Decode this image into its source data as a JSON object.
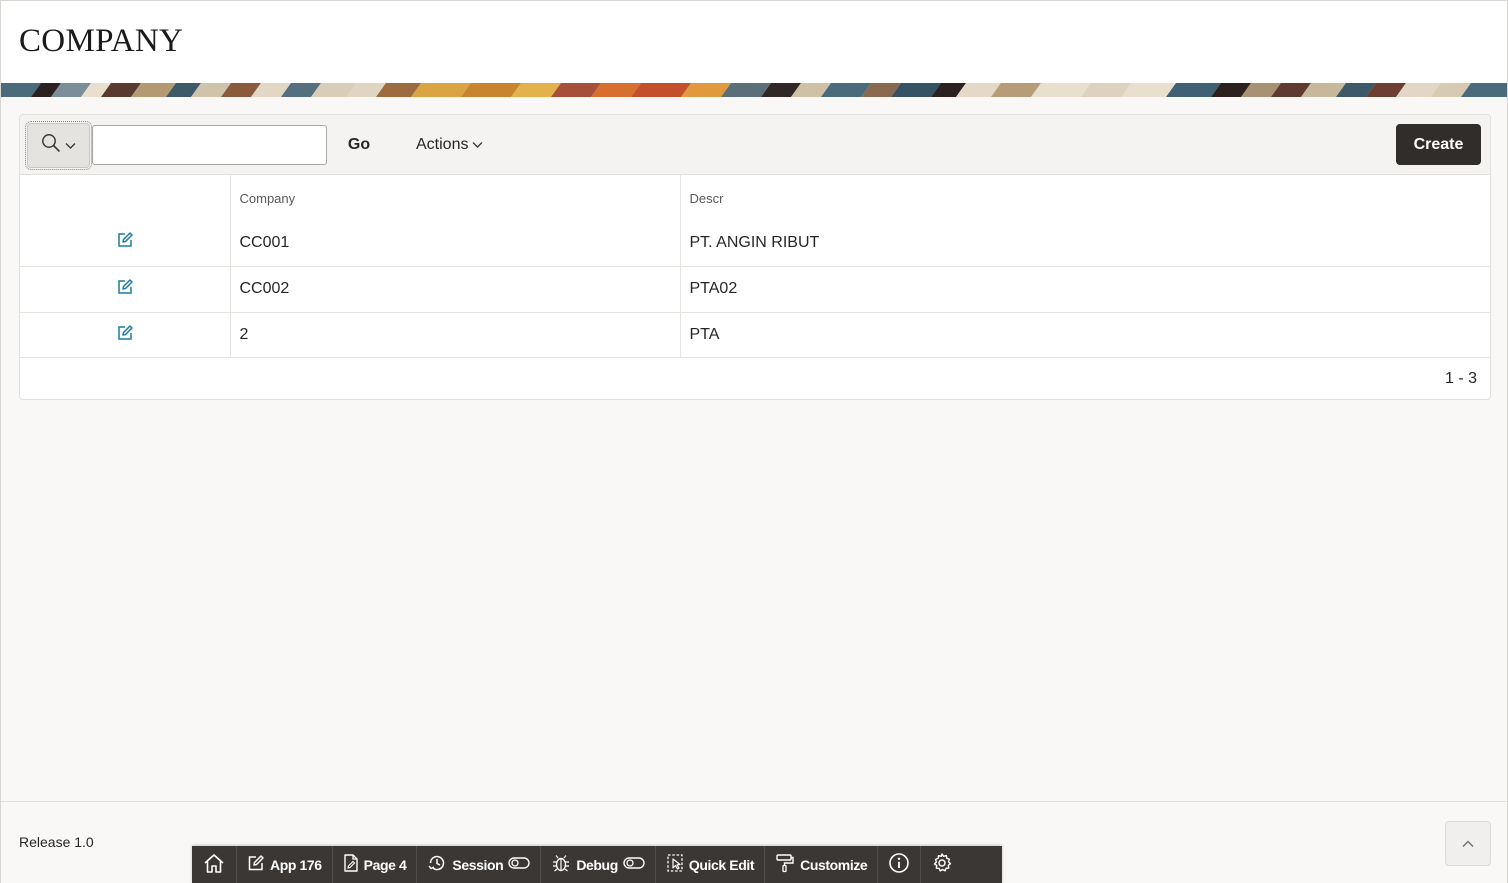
{
  "page": {
    "title": "COMPANY"
  },
  "toolbar": {
    "search_value": "",
    "go_label": "Go",
    "actions_label": "Actions",
    "create_label": "Create"
  },
  "report": {
    "columns": [
      "",
      "Company",
      "Descr"
    ],
    "rows": [
      {
        "company": "CC001",
        "descr": "PT. ANGIN RIBUT"
      },
      {
        "company": "CC002",
        "descr": "PTA02"
      },
      {
        "company": "2",
        "descr": "PTA"
      }
    ],
    "pagination": "1 - 3"
  },
  "footer": {
    "release": "Release 1.0"
  },
  "dev_toolbar": {
    "items": [
      {
        "label": "",
        "icon": "home-icon"
      },
      {
        "label": "App 176",
        "icon": "edit-icon"
      },
      {
        "label": "Page 4",
        "icon": "page-edit-icon"
      },
      {
        "label": "Session",
        "icon": "session-icon"
      },
      {
        "label": "Debug",
        "icon": "bug-icon"
      },
      {
        "label": "Quick Edit",
        "icon": "quick-edit-icon"
      },
      {
        "label": "Customize",
        "icon": "paint-roller-icon"
      },
      {
        "label": "",
        "icon": "info-icon"
      },
      {
        "label": "",
        "icon": "gear-icon"
      }
    ]
  },
  "colors": {
    "accent": "#1c7ba3",
    "create_button": "#312d2a",
    "dev_toolbar": "#3b3734",
    "page_background": "#f9f8f6"
  }
}
